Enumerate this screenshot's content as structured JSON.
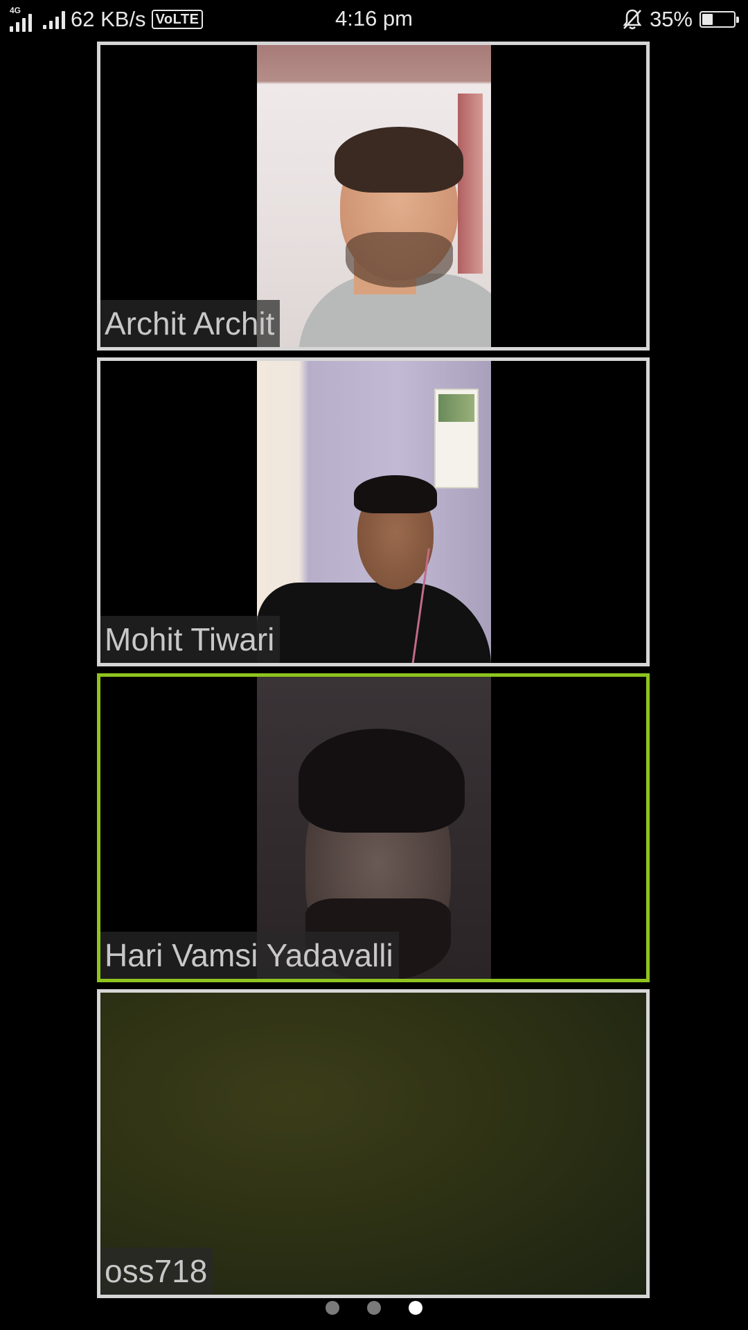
{
  "status_bar": {
    "network_type": "4G",
    "data_speed": "62 KB/s",
    "volte_label": "VoLTE",
    "time": "4:16 pm",
    "battery_percent": "35%",
    "battery_level": 0.35,
    "icons": [
      "signal-icon",
      "signal-icon",
      "volte-icon",
      "bell-muted-icon",
      "battery-icon"
    ]
  },
  "participants": [
    {
      "name": "Archit Archit",
      "active_speaker": false,
      "video": "on"
    },
    {
      "name": "Mohit Tiwari",
      "active_speaker": false,
      "video": "on"
    },
    {
      "name": "Hari Vamsi Yadavalli",
      "active_speaker": true,
      "video": "on"
    },
    {
      "name": "oss718",
      "active_speaker": false,
      "video": "on"
    }
  ],
  "pager": {
    "total_pages": 3,
    "current_page": 3
  },
  "colors": {
    "background": "#000000",
    "tile_border": "#d6d6d6",
    "active_speaker_border": "#8fc41f",
    "name_text": "#c8c8c8"
  }
}
